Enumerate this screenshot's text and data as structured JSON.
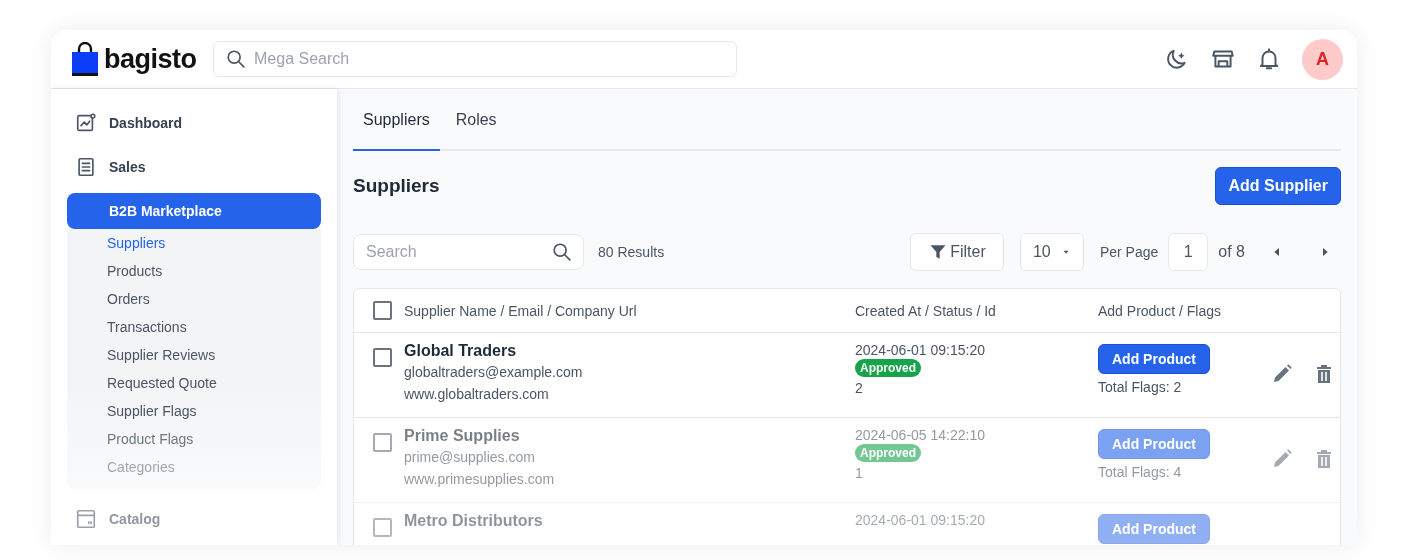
{
  "header": {
    "logo": "bagisto",
    "search": {
      "placeholder": "Mega Search"
    },
    "avatar": "A"
  },
  "sidebar": {
    "items": [
      {
        "label": "Dashboard",
        "selected": false
      },
      {
        "label": "Sales",
        "selected": false
      },
      {
        "label": "B2B Marketplace",
        "selected": true,
        "children": [
          {
            "label": "Suppliers",
            "selected": true
          },
          {
            "label": "Products",
            "selected": false
          },
          {
            "label": "Orders",
            "selected": false
          },
          {
            "label": "Transactions",
            "selected": false
          },
          {
            "label": "Supplier Reviews",
            "selected": false
          },
          {
            "label": "Requested Quote",
            "selected": false
          },
          {
            "label": "Supplier Flags",
            "selected": false
          },
          {
            "label": "Product Flags",
            "selected": false
          },
          {
            "label": "Categories",
            "selected": false
          }
        ]
      },
      {
        "label": "Catalog",
        "selected": false
      }
    ]
  },
  "tabs": [
    {
      "label": "Suppliers",
      "selected": true
    },
    {
      "label": "Roles",
      "selected": false
    }
  ],
  "page_title": "Suppliers",
  "add_button": "Add Supplier",
  "toolbar": {
    "search": {
      "placeholder": "Search"
    },
    "results": "80 Results",
    "filter": "Filter",
    "per_page_value": "10",
    "per_page_label": "Per Page",
    "page": "1",
    "page_total": "of 8"
  },
  "table": {
    "select_all_checked": false,
    "columns": [
      "Supplier Name / Email / Company Url",
      "Created At / Status / Id",
      "Add Product / Flags"
    ],
    "rows": [
      {
        "checked": false,
        "name": "Global Traders",
        "email": "globaltraders@example.com",
        "url": "www.globaltraders.com",
        "created": "2024-06-01 09:15:20",
        "status": "Approved",
        "id": "2",
        "add": "Add Product",
        "flags": "Total Flags: 2"
      },
      {
        "checked": false,
        "name": "Prime Supplies",
        "email": "prime@supplies.com",
        "url": "www.primesupplies.com",
        "created": "2024-06-05 14:22:10",
        "status": "Approved",
        "id": "1",
        "add": "Add Product",
        "flags": "Total Flags: 4"
      },
      {
        "checked": false,
        "name": "Metro Distributors",
        "created": "2024-06-01 09:15:20",
        "add": "Add Product"
      }
    ]
  }
}
